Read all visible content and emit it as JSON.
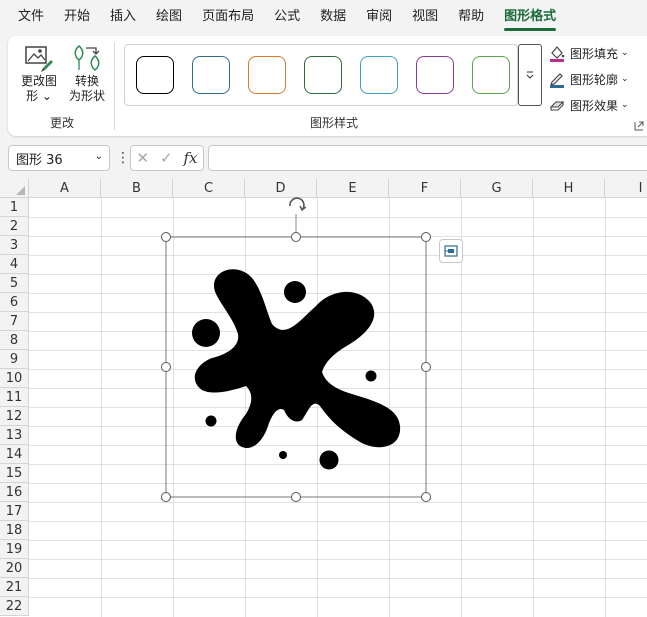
{
  "menu": [
    "文件",
    "开始",
    "插入",
    "绘图",
    "页面布局",
    "公式",
    "数据",
    "审阅",
    "视图",
    "帮助",
    "图形格式"
  ],
  "ribbon": {
    "change_group": {
      "edit_shape": {
        "line1": "更改图",
        "line2": "形 ⌄"
      },
      "convert_shape": {
        "line1": "转换",
        "line2": "为形状"
      },
      "label": "更改"
    },
    "styles_group": {
      "label": "图形样式",
      "swatch_colors": [
        "#000000",
        "#2e6b8f",
        "#d97b2b",
        "#2f6b3a",
        "#3aa3c3",
        "#8a3a9e",
        "#5aa84a"
      ]
    },
    "fill": "图形填充",
    "outline": "图形轮廓",
    "effects": "图形效果"
  },
  "formula_bar": {
    "name_box": "图形 36",
    "dots": "⋮",
    "cancel": "✕",
    "enter": "✓",
    "fx": "fx",
    "value": ""
  },
  "grid": {
    "columns": [
      "A",
      "B",
      "C",
      "D",
      "E",
      "F",
      "G",
      "H",
      "I"
    ],
    "rows": [
      "1",
      "2",
      "3",
      "4",
      "5",
      "6",
      "7",
      "8",
      "9",
      "10",
      "11",
      "12",
      "13",
      "14",
      "15",
      "16",
      "17",
      "18",
      "19",
      "20",
      "21",
      "22"
    ]
  },
  "shape": {
    "icon": "ink-splash-graphic",
    "fill": "#000000"
  }
}
